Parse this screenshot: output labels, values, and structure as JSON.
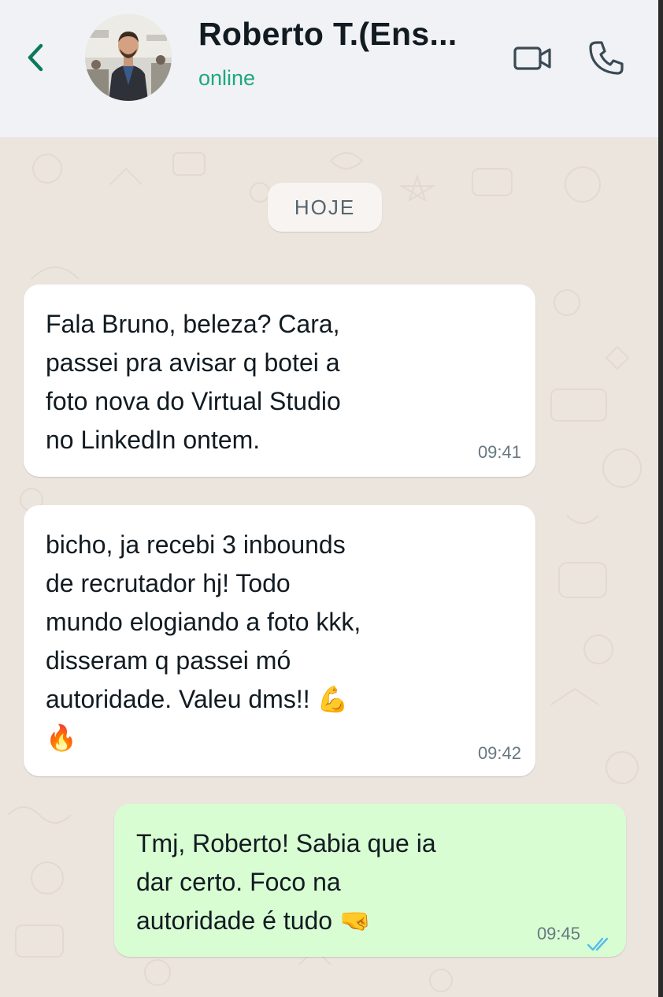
{
  "header": {
    "contact_name": "Roberto T.(Ens...",
    "status": "online",
    "icons": [
      "back-chevron-icon",
      "avatar-photo",
      "video-call-icon",
      "phone-icon"
    ]
  },
  "chat": {
    "date_label": "HOJE",
    "messages": [
      {
        "direction": "incoming",
        "lines": [
          "Fala Bruno, beleza? Cara,",
          "passei pra avisar q botei a",
          "foto nova do Virtual Studio",
          "no LinkedIn ontem."
        ],
        "time": "09:41"
      },
      {
        "direction": "incoming",
        "lines": [
          "bicho, ja recebi 3 inbounds",
          "de recrutador hj! Todo",
          "mundo elogiando a foto kkk,",
          "disseram q passei mó",
          "autoridade. Valeu dms!! 💪",
          "🔥"
        ],
        "time": "09:42"
      },
      {
        "direction": "outgoing",
        "lines": [
          "Tmj, Roberto! Sabia que ia",
          "dar certo. Foco na",
          "autoridade é tudo 🤜"
        ],
        "time": "09:45",
        "read": true
      }
    ]
  },
  "colors": {
    "header_bg": "#f0f2f5",
    "accent_green": "#1fa77d",
    "back_icon": "#0b7a5c",
    "chat_bg": "#ece5dd",
    "incoming_bubble": "#ffffff",
    "outgoing_bubble": "#d9fdd3",
    "read_ticks": "#53bdeb"
  }
}
